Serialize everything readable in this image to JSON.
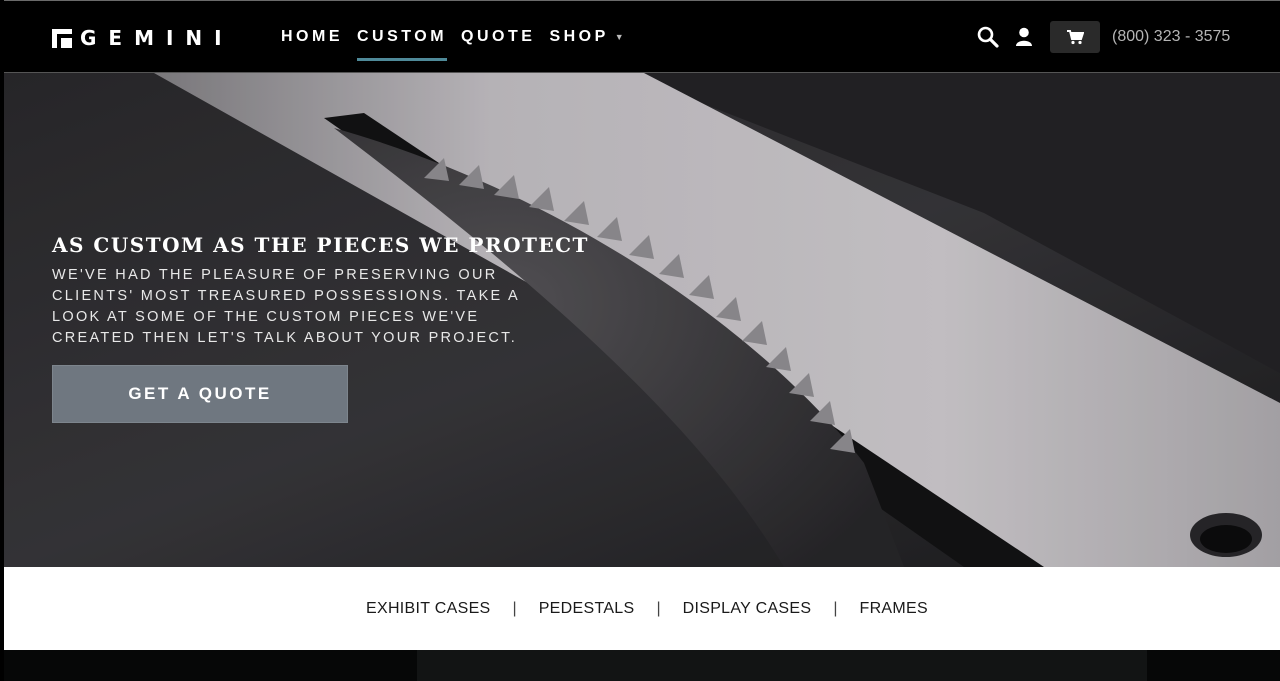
{
  "header": {
    "logo_text": "GEMINI",
    "nav": [
      {
        "label": "HOME",
        "active": false
      },
      {
        "label": "CUSTOM",
        "active": true
      },
      {
        "label": "QUOTE",
        "active": false
      },
      {
        "label": "SHOP",
        "active": false,
        "has_dropdown": true
      }
    ],
    "icons": [
      "search-icon",
      "account-icon",
      "cart-icon"
    ],
    "phone": "(800) 323 - 3575",
    "active_underline_color": "#4f8a99"
  },
  "hero": {
    "title": "AS CUSTOM AS THE PIECES WE PROTECT",
    "text": "WE'VE HAD THE PLEASURE OF PRESERVING OUR CLIENTS' MOST TREASURED POSSESSIONS. TAKE A LOOK AT SOME OF THE CUSTOM PIECES WE'VE CREATED THEN LET'S TALK ABOUT YOUR PROJECT.",
    "button_label": "GET A QUOTE",
    "button_color": "#6f7780"
  },
  "categories": [
    "EXHIBIT CASES",
    "PEDESTALS",
    "DISPLAY CASES",
    "FRAMES"
  ]
}
